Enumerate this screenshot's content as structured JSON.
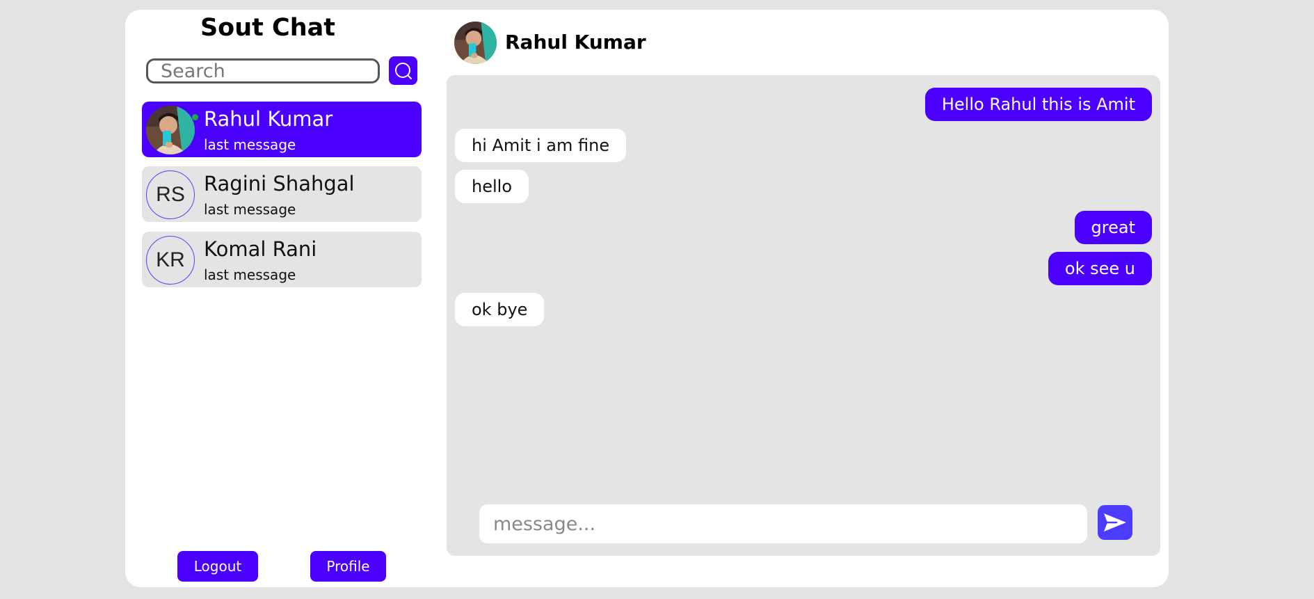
{
  "app": {
    "title": "Sout Chat"
  },
  "search": {
    "placeholder": "Search"
  },
  "contacts": [
    {
      "name": "Rahul Kumar",
      "last_message": "last message",
      "avatar": "photo",
      "online": true,
      "active": true
    },
    {
      "name": "Ragini Shahgal",
      "last_message": "last message",
      "initials": "RS"
    },
    {
      "name": "Komal Rani",
      "last_message": "last message",
      "initials": "KR"
    }
  ],
  "buttons": {
    "logout": "Logout",
    "profile": "Profile"
  },
  "chat": {
    "contact_name": "Rahul Kumar",
    "messages": [
      {
        "text": "Hello Rahul this is Amit",
        "direction": "out"
      },
      {
        "text": "hi Amit i am fine",
        "direction": "in"
      },
      {
        "text": "hello",
        "direction": "in"
      },
      {
        "text": "great",
        "direction": "out"
      },
      {
        "text": "ok see u",
        "direction": "out"
      },
      {
        "text": "ok bye",
        "direction": "in"
      }
    ],
    "input_placeholder": "message..."
  },
  "colors": {
    "accent": "#4b00ff",
    "send_button": "#4b3cff",
    "panel": "#e4e4e4",
    "page_background": "#e3e3e3",
    "online": "#1ea64a"
  },
  "icons": {
    "search": "search-icon",
    "send": "send-icon"
  }
}
